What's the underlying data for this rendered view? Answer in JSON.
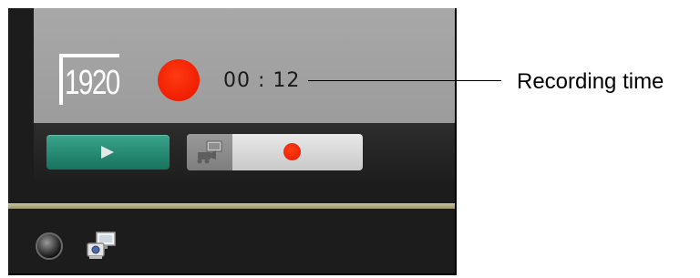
{
  "monitor": {
    "resolution": "1920",
    "record_indicator": "recording",
    "recording_time": "00 : 12"
  },
  "controls": {
    "play_icon": "play-icon",
    "camera_icon": "camera-icon",
    "record_dot_icon": "record-dot-icon"
  },
  "status": {
    "lamp_icon": "status-lamp-icon",
    "network_icon": "network-camera-icon"
  },
  "annotation": {
    "label": "Recording time"
  },
  "colors": {
    "record_red": "#f01e00",
    "play_green": "#2a8c74",
    "divider_olive": "#b8b386"
  }
}
